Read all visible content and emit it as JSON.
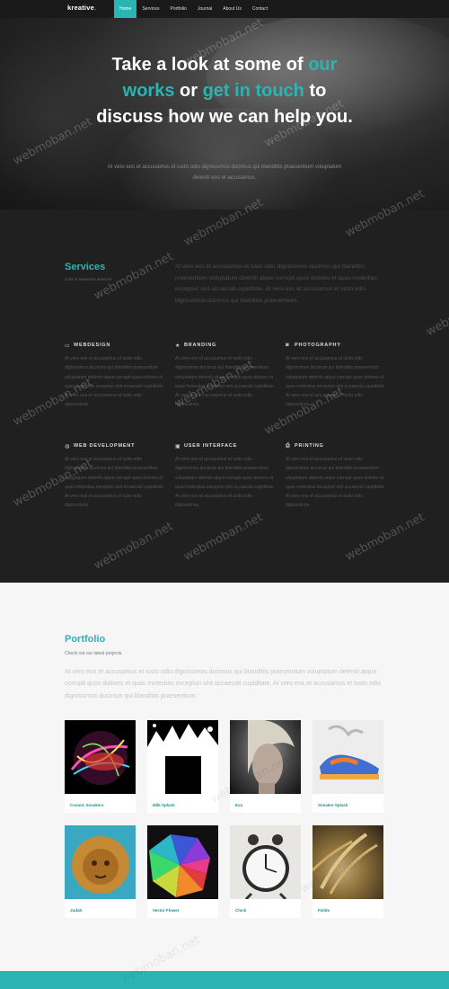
{
  "brand": {
    "name": "kreative",
    "dot": "."
  },
  "nav": {
    "items": [
      "Home",
      "Services",
      "Portfolio",
      "Journal",
      "About Us",
      "Contact"
    ],
    "active": "Home"
  },
  "hero": {
    "title_1": "Take a look at some of ",
    "title_hl_1": "our works",
    "title_2": " or ",
    "title_hl_2": "get in touch",
    "title_3": " to discuss how we can help you.",
    "subtitle": "At vero eos et accusamus et iusto odio dignissimos ducimus qui blanditiis praesentium voluptatum deleniti eos et accusamus."
  },
  "services": {
    "title": "Services",
    "subtitle": "a list of awesome services",
    "intro": "At vero eos et accusamus et iusto odio dignissimos ducimus qui blanditiis praesentium voluptatum deleniti atque corrupti quos dolores et quas molestias excepturi sint occaecati cupiditate. At vero eos et accusamus et iusto odio dignissimos ducimus qui blanditiis praesentium.",
    "items": [
      {
        "title": "WEBDESIGN",
        "icon": "monitor-icon",
        "text": "At vero eos et accusamus et iusto odio dignissimos ducimus qui blanditiis praesentium voluptatum deleniti atque corrupti quos dolores et quas molestias excepturi sint occaecati cupiditate. At vero eos et accusamus et iusto odio dignissimos."
      },
      {
        "title": "BRANDING",
        "icon": "star-icon",
        "text": "At vero eos et accusamus et iusto odio dignissimos ducimus qui blanditiis praesentium voluptatum deleniti atque corrupti quos dolores et quas molestias excepturi sint occaecati cupiditate. At vero eos et accusamus et iusto odio dignissimos."
      },
      {
        "title": "PHOTOGRAPHY",
        "icon": "camera-icon",
        "text": "At vero eos et accusamus et iusto odio dignissimos ducimus qui blanditiis praesentium voluptatum deleniti atque corrupti quos dolores et quas molestias excepturi sint occaecati cupiditate. At vero eos et accusamus et iusto odio dignissimos."
      },
      {
        "title": "WEB DEVELOPMENT",
        "icon": "globe-icon",
        "text": "At vero eos et accusamus et iusto odio dignissimos ducimus qui blanditiis praesentium voluptatum deleniti atque corrupti quos dolores et quas molestias excepturi sint occaecati cupiditate. At vero eos et accusamus et iusto odio dignissimos."
      },
      {
        "title": "USER INTERFACE",
        "icon": "window-icon",
        "text": "At vero eos et accusamus et iusto odio dignissimos ducimus qui blanditiis praesentium voluptatum deleniti atque corrupti quos dolores et quas molestias excepturi sint occaecati cupiditate. At vero eos et accusamus et iusto odio dignissimos."
      },
      {
        "title": "PRINTING",
        "icon": "printer-icon",
        "text": "At vero eos et accusamus et iusto odio dignissimos ducimus qui blanditiis praesentium voluptatum deleniti atque corrupti quos dolores et quas molestias excepturi sint occaecati cupiditate. At vero eos et accusamus et iusto odio dignissimos."
      }
    ]
  },
  "portfolio": {
    "title": "Portfolio",
    "subtitle": "Check out our latest projects.",
    "intro": "At vero eos et accusamus et iusto odio dignissimos ducimus qui blanditiis praesentium voluptatum deleniti atque corrupti quos dolores et quas molestias excepturi sint occaecati cupiditate. At vero eos et accusamus et iusto odio dignissimos ducimus qui blanditiis praesentium.",
    "items": [
      {
        "caption": "Cosmic Sneakers"
      },
      {
        "caption": "Milk Splash"
      },
      {
        "caption": "Eva"
      },
      {
        "caption": "Sneaker Splash"
      },
      {
        "caption": "Judah"
      },
      {
        "caption": "Vector Flower"
      },
      {
        "caption": "Clock"
      },
      {
        "caption": "Fields"
      }
    ]
  },
  "watermark": "webmoban.net",
  "colors": {
    "accent": "#2ab5b3",
    "dark": "#202020",
    "nav": "#1a1a1a"
  }
}
